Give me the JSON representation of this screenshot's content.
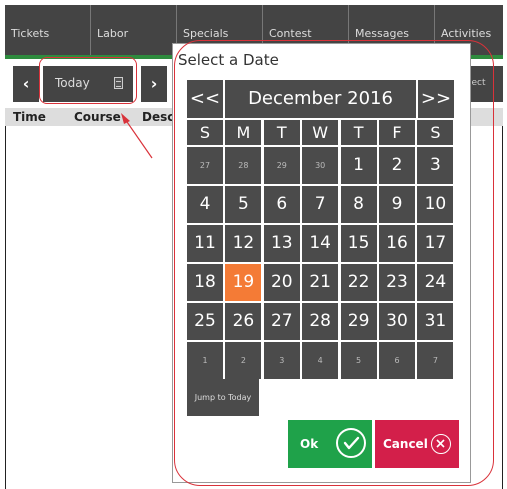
{
  "tabs": [
    "Tickets",
    "Labor",
    "Specials",
    "Contest",
    "Messages",
    "Activities"
  ],
  "nav": {
    "prev_label": "‹",
    "next_label": "›",
    "today_label": "Today",
    "select_label": "lect"
  },
  "columns": [
    "Time",
    "Course",
    "Desc"
  ],
  "picker": {
    "title": "Select a Date",
    "prev_month_label": "<<",
    "month_label": "December 2016",
    "next_month_label": ">>",
    "weekdays": [
      "S",
      "M",
      "T",
      "W",
      "T",
      "F",
      "S"
    ],
    "weeks": [
      [
        "27",
        "28",
        "29",
        "30",
        "1",
        "2",
        "3"
      ],
      [
        "4",
        "5",
        "6",
        "7",
        "8",
        "9",
        "10"
      ],
      [
        "11",
        "12",
        "13",
        "14",
        "15",
        "16",
        "17"
      ],
      [
        "18",
        "19",
        "20",
        "21",
        "22",
        "23",
        "24"
      ],
      [
        "25",
        "26",
        "27",
        "28",
        "29",
        "30",
        "31"
      ],
      [
        "1",
        "2",
        "3",
        "4",
        "5",
        "6",
        "7"
      ]
    ],
    "selected_day": "19",
    "jump_label": "Jump to Today",
    "ok_label": "Ok",
    "cancel_label": "Cancel"
  },
  "colors": {
    "selected": "#f47b36",
    "ok": "#1fa24a",
    "cancel": "#d31f4a",
    "annotation": "#d9323a"
  }
}
